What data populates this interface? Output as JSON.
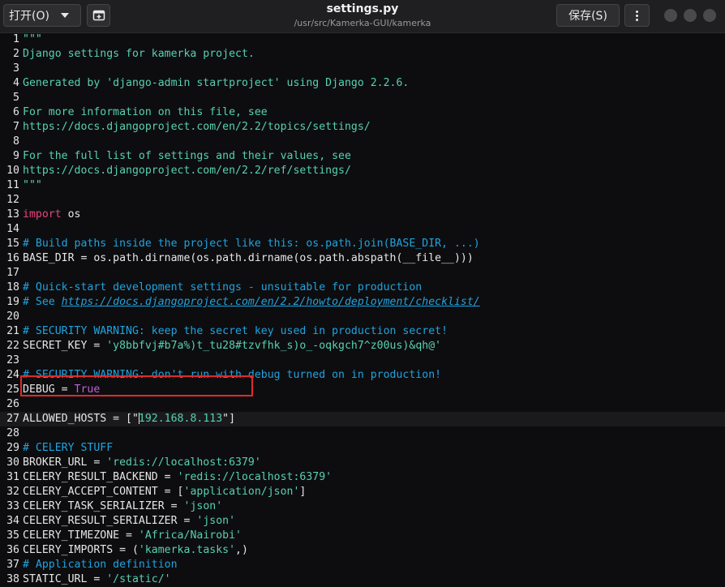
{
  "toolbar": {
    "open_label": "打开(O)",
    "save_label": "保存(S)"
  },
  "window": {
    "title": "settings.py",
    "path": "/usr/src/Kamerka-GUI/kamerka"
  },
  "colors": {
    "docstring": "#57d1b0",
    "comment": "#1fa3e0",
    "keyword": "#e8457a",
    "constant": "#c061d6",
    "highlight_border": "#e02a2a"
  },
  "editor": {
    "current_line": 27,
    "lines": [
      {
        "n": "1",
        "segs": [
          {
            "t": "\"\"\"",
            "c": "doc"
          }
        ]
      },
      {
        "n": "2",
        "segs": [
          {
            "t": "Django settings for kamerka project.",
            "c": "doc"
          }
        ]
      },
      {
        "n": "3",
        "segs": []
      },
      {
        "n": "4",
        "segs": [
          {
            "t": "Generated by 'django-admin startproject' using Django 2.2.6.",
            "c": "doc"
          }
        ]
      },
      {
        "n": "5",
        "segs": []
      },
      {
        "n": "6",
        "segs": [
          {
            "t": "For more information on this file, see",
            "c": "doc"
          }
        ]
      },
      {
        "n": "7",
        "segs": [
          {
            "t": "https://docs.djangoproject.com/en/2.2/topics/settings/",
            "c": "doc"
          }
        ]
      },
      {
        "n": "8",
        "segs": []
      },
      {
        "n": "9",
        "segs": [
          {
            "t": "For the full list of settings and their values, see",
            "c": "doc"
          }
        ]
      },
      {
        "n": "10",
        "segs": [
          {
            "t": "https://docs.djangoproject.com/en/2.2/ref/settings/",
            "c": "doc"
          }
        ]
      },
      {
        "n": "11",
        "segs": [
          {
            "t": "\"\"\"",
            "c": "doc"
          }
        ]
      },
      {
        "n": "12",
        "segs": []
      },
      {
        "n": "13",
        "segs": [
          {
            "t": "import",
            "c": "kw"
          },
          {
            "t": " os",
            "c": "plain"
          }
        ]
      },
      {
        "n": "14",
        "segs": []
      },
      {
        "n": "15",
        "segs": [
          {
            "t": "# Build paths inside the project like this: os.path.join(BASE_DIR, ...)",
            "c": "comment"
          }
        ]
      },
      {
        "n": "16",
        "segs": [
          {
            "t": "BASE_DIR = os.path.dirname(os.path.dirname(os.path.abspath(__file__)))",
            "c": "plain"
          }
        ]
      },
      {
        "n": "17",
        "segs": []
      },
      {
        "n": "18",
        "segs": [
          {
            "t": "# Quick-start development settings - unsuitable for production",
            "c": "comment"
          }
        ]
      },
      {
        "n": "19",
        "segs": [
          {
            "t": "# See ",
            "c": "comment"
          },
          {
            "t": "https://docs.djangoproject.com/en/2.2/howto/deployment/checklist/",
            "c": "link"
          }
        ]
      },
      {
        "n": "20",
        "segs": []
      },
      {
        "n": "21",
        "segs": [
          {
            "t": "# SECURITY WARNING: keep the secret key used in production secret!",
            "c": "comment"
          }
        ]
      },
      {
        "n": "22",
        "segs": [
          {
            "t": "SECRET_KEY = ",
            "c": "plain"
          },
          {
            "t": "'y8bbfvj#b7a%)t_tu28#tzvfhk_s)o_-oqkgch7^z00us)&qh@'",
            "c": "str"
          }
        ]
      },
      {
        "n": "23",
        "segs": []
      },
      {
        "n": "24",
        "segs": [
          {
            "t": "# SECURITY WARNING: don't run with debug turned on in production!",
            "c": "comment"
          }
        ]
      },
      {
        "n": "25",
        "segs": [
          {
            "t": "DEBUG = ",
            "c": "plain"
          },
          {
            "t": "True",
            "c": "const"
          }
        ]
      },
      {
        "n": "26",
        "segs": []
      },
      {
        "n": "27",
        "segs": [
          {
            "t": "ALLOWED_HOSTS = [\"",
            "c": "plain"
          },
          {
            "t": "",
            "c": "cursor"
          },
          {
            "t": "192.168.8.113",
            "c": "str"
          },
          {
            "t": "\"]",
            "c": "plain"
          }
        ]
      },
      {
        "n": "28",
        "segs": []
      },
      {
        "n": "29",
        "segs": [
          {
            "t": "# CELERY STUFF",
            "c": "comment"
          }
        ]
      },
      {
        "n": "30",
        "segs": [
          {
            "t": "BROKER_URL = ",
            "c": "plain"
          },
          {
            "t": "'redis://localhost:6379'",
            "c": "str"
          }
        ]
      },
      {
        "n": "31",
        "segs": [
          {
            "t": "CELERY_RESULT_BACKEND = ",
            "c": "plain"
          },
          {
            "t": "'redis://localhost:6379'",
            "c": "str"
          }
        ]
      },
      {
        "n": "32",
        "segs": [
          {
            "t": "CELERY_ACCEPT_CONTENT = [",
            "c": "plain"
          },
          {
            "t": "'application/json'",
            "c": "str"
          },
          {
            "t": "]",
            "c": "plain"
          }
        ]
      },
      {
        "n": "33",
        "segs": [
          {
            "t": "CELERY_TASK_SERIALIZER = ",
            "c": "plain"
          },
          {
            "t": "'json'",
            "c": "str"
          }
        ]
      },
      {
        "n": "34",
        "segs": [
          {
            "t": "CELERY_RESULT_SERIALIZER = ",
            "c": "plain"
          },
          {
            "t": "'json'",
            "c": "str"
          }
        ]
      },
      {
        "n": "35",
        "segs": [
          {
            "t": "CELERY_TIMEZONE = ",
            "c": "plain"
          },
          {
            "t": "'Africa/Nairobi'",
            "c": "str"
          }
        ]
      },
      {
        "n": "36",
        "segs": [
          {
            "t": "CELERY_IMPORTS = (",
            "c": "plain"
          },
          {
            "t": "'kamerka.tasks'",
            "c": "str"
          },
          {
            "t": ",)",
            "c": "plain"
          }
        ]
      },
      {
        "n": "37",
        "segs": [
          {
            "t": "# Application definition",
            "c": "comment"
          }
        ]
      },
      {
        "n": "38",
        "segs": [
          {
            "t": "STATIC_URL = ",
            "c": "plain"
          },
          {
            "t": "'/static/'",
            "c": "str"
          }
        ]
      }
    ]
  }
}
